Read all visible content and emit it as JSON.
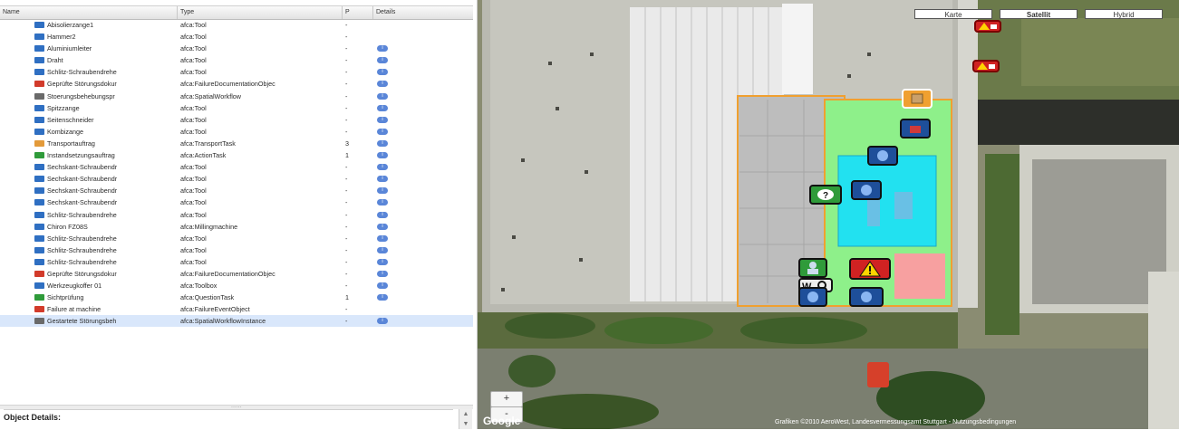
{
  "grid": {
    "columns": {
      "name": "Name",
      "type": "Type",
      "p": "P",
      "details": "Details"
    },
    "rows": [
      {
        "name": "Abisolierzange1",
        "type": "afca:Tool",
        "p": "-",
        "details": false,
        "icon": "tool-icon",
        "iconColor": "#2f6fc2"
      },
      {
        "name": "Hammer2",
        "type": "afca:Tool",
        "p": "-",
        "details": false,
        "icon": "tool-icon",
        "iconColor": "#2f6fc2"
      },
      {
        "name": "Aluminiumleiter",
        "type": "afca:Tool",
        "p": "-",
        "details": true,
        "icon": "tool-icon",
        "iconColor": "#2f6fc2"
      },
      {
        "name": "Draht",
        "type": "afca:Tool",
        "p": "-",
        "details": true,
        "icon": "tool-icon",
        "iconColor": "#2f6fc2"
      },
      {
        "name": "Schlitz-Schraubendrehe",
        "type": "afca:Tool",
        "p": "-",
        "details": true,
        "icon": "tool-icon",
        "iconColor": "#2f6fc2"
      },
      {
        "name": "Geprüfte Störungsdokur",
        "type": "afca:FailureDocumentationObjec",
        "p": "-",
        "details": true,
        "icon": "failure-documentation-icon",
        "iconColor": "#d23b2b"
      },
      {
        "name": "Stoerungsbehebungspr",
        "type": "afca:SpatialWorkflow",
        "p": "-",
        "details": true,
        "icon": "workflow-icon",
        "iconColor": "#6a6a6a"
      },
      {
        "name": "Spitzzange",
        "type": "afca:Tool",
        "p": "-",
        "details": true,
        "icon": "tool-icon",
        "iconColor": "#2f6fc2"
      },
      {
        "name": "Seitenschneider",
        "type": "afca:Tool",
        "p": "-",
        "details": true,
        "icon": "tool-icon",
        "iconColor": "#2f6fc2"
      },
      {
        "name": "Kombizange",
        "type": "afca:Tool",
        "p": "-",
        "details": true,
        "icon": "tool-icon",
        "iconColor": "#2f6fc2"
      },
      {
        "name": "Transportauftrag",
        "type": "afca:TransportTask",
        "p": "3",
        "details": true,
        "icon": "transport-icon",
        "iconColor": "#e39a3a"
      },
      {
        "name": "Instandsetzungsauftrag",
        "type": "afca:ActionTask",
        "p": "1",
        "details": true,
        "icon": "action-task-icon",
        "iconColor": "#2f9b3a"
      },
      {
        "name": "Sechskant-Schraubendr",
        "type": "afca:Tool",
        "p": "-",
        "details": true,
        "icon": "tool-icon",
        "iconColor": "#2f6fc2"
      },
      {
        "name": "Sechskant-Schraubendr",
        "type": "afca:Tool",
        "p": "-",
        "details": true,
        "icon": "tool-icon",
        "iconColor": "#2f6fc2"
      },
      {
        "name": "Sechskant-Schraubendr",
        "type": "afca:Tool",
        "p": "-",
        "details": true,
        "icon": "tool-icon",
        "iconColor": "#2f6fc2"
      },
      {
        "name": "Sechskant-Schraubendr",
        "type": "afca:Tool",
        "p": "-",
        "details": true,
        "icon": "tool-icon",
        "iconColor": "#2f6fc2"
      },
      {
        "name": "Schlitz-Schraubendrehe",
        "type": "afca:Tool",
        "p": "-",
        "details": true,
        "icon": "tool-icon",
        "iconColor": "#2f6fc2"
      },
      {
        "name": "Chiron FZ08S",
        "type": "afca:Millingmachine",
        "p": "-",
        "details": true,
        "icon": "machine-icon",
        "iconColor": "#2f6fc2"
      },
      {
        "name": "Schlitz-Schraubendrehe",
        "type": "afca:Tool",
        "p": "-",
        "details": true,
        "icon": "tool-icon",
        "iconColor": "#2f6fc2"
      },
      {
        "name": "Schlitz-Schraubendrehe",
        "type": "afca:Tool",
        "p": "-",
        "details": true,
        "icon": "tool-icon",
        "iconColor": "#2f6fc2"
      },
      {
        "name": "Schlitz-Schraubendrehe",
        "type": "afca:Tool",
        "p": "-",
        "details": true,
        "icon": "tool-icon",
        "iconColor": "#2f6fc2"
      },
      {
        "name": "Geprüfte Störungsdokur",
        "type": "afca:FailureDocumentationObjec",
        "p": "-",
        "details": true,
        "icon": "failure-documentation-icon",
        "iconColor": "#d23b2b"
      },
      {
        "name": "Werkzeugkoffer 01",
        "type": "afca:Toolbox",
        "p": "-",
        "details": true,
        "icon": "toolbox-icon",
        "iconColor": "#2f6fc2"
      },
      {
        "name": "Sichtprüfung",
        "type": "afca:QuestionTask",
        "p": "1",
        "details": true,
        "icon": "question-task-icon",
        "iconColor": "#2f9b3a"
      },
      {
        "name": "Failure at machine",
        "type": "afca:FailureEventObject",
        "p": "-",
        "details": false,
        "icon": "failure-event-icon",
        "iconColor": "#d23b2b"
      },
      {
        "name": "Gestartete Störungsbeh",
        "type": "afca:SpatialWorkflowInstance",
        "p": "-",
        "details": true,
        "icon": "workflow-instance-icon",
        "iconColor": "#6a6a6a",
        "selected": true
      }
    ]
  },
  "details_panel": {
    "label": "Object Details:",
    "splitter_grip": "......"
  },
  "map": {
    "type_buttons": [
      "Karte",
      "Satellit",
      "Hybrid"
    ],
    "active_type": "Satellit",
    "zoom_in": "+",
    "zoom_out": "-",
    "logo": "Google",
    "copyright": "Grafiken ©2010 AeroWest, Landesvermessungsamt Stuttgart - Nutzungsbedingungen"
  },
  "colors": {
    "selected_row": "#d9e7fb",
    "details_icon": "#5a86d8",
    "tool_icon": "#2f6fc2",
    "failure_red": "#d23b2b",
    "task_green": "#2f9b3a",
    "zone_green": "#8ef08a",
    "zone_cyan": "#22e1f0",
    "zone_orange": "#f0a030"
  }
}
